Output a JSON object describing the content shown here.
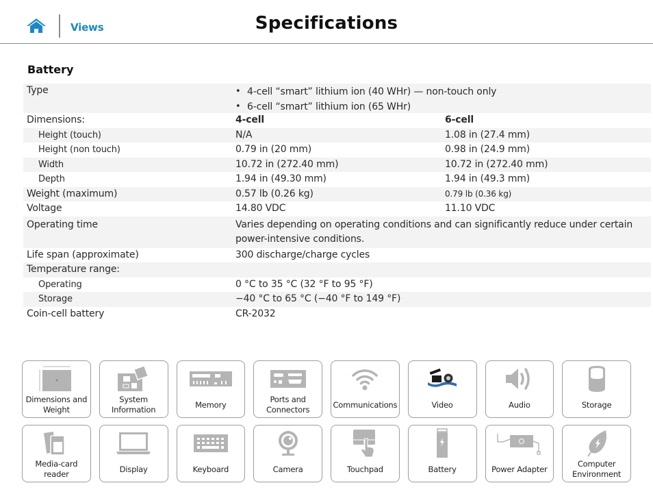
{
  "header": {
    "home_icon": "home-icon",
    "views_label": "Views",
    "title": "Specifications"
  },
  "colors": {
    "accent": "#1b87c9",
    "row_shade": "#f3f3f3",
    "icon_gray": "#b4b4b4",
    "tile_border": "#9d9d9d"
  },
  "section": {
    "title": "Battery",
    "type_label": "Type",
    "type_items": [
      "4-cell “smart” lithium ion (40 WHr) — non-touch only",
      "6-cell “smart” lithium ion (65 WHr)"
    ],
    "rows": [
      {
        "label": "Dimensions:",
        "c1": "4-cell",
        "c2": "6-cell"
      },
      {
        "label": "Height (touch)",
        "c1": "N/A",
        "c2": "1.08 in (27.4 mm)"
      },
      {
        "label": "Height (non touch)",
        "c1": "0.79 in (20 mm)",
        "c2": "0.98 in (24.9 mm)"
      },
      {
        "label": "Width",
        "c1": "10.72 in (272.40 mm)",
        "c2": "10.72 in (272.40 mm)"
      },
      {
        "label": "Depth",
        "c1": "1.94 in (49.30 mm)",
        "c2": "1.94 in (49.3 mm)"
      },
      {
        "label": "Weight (maximum)",
        "c1": "0.57 lb (0.26 kg)",
        "c2": "0.79 lb (0.36 kg)"
      },
      {
        "label": "Voltage",
        "c1": "14.80 VDC",
        "c2": "11.10 VDC"
      },
      {
        "label": "Operating time",
        "value": "Varies depending on operating conditions and can significantly reduce under certain power-intensive conditions."
      },
      {
        "label": "Life span (approximate)",
        "value": "300 discharge/charge cycles"
      },
      {
        "label": "Temperature range:",
        "value": ""
      },
      {
        "label": "Operating",
        "value": "0 °C to 35 °C (32 °F to 95 °F)"
      },
      {
        "label": "Storage",
        "value": "−40 °C to 65 °C (−40 °F to 149 °F)"
      },
      {
        "label": "Coin-cell battery",
        "value": "CR-2032"
      }
    ]
  },
  "tiles": [
    {
      "label": "Dimensions and Weight",
      "icon": "laptop-dimensions-icon"
    },
    {
      "label": "System Information",
      "icon": "motherboard-icon"
    },
    {
      "label": "Memory",
      "icon": "memory-module-icon"
    },
    {
      "label": "Ports and Connectors",
      "icon": "ports-icon"
    },
    {
      "label": "Communications",
      "icon": "wifi-icon"
    },
    {
      "label": "Video",
      "icon": "film-clapper-icon"
    },
    {
      "label": "Audio",
      "icon": "speaker-icon"
    },
    {
      "label": "Storage",
      "icon": "storage-cylinder-icon"
    },
    {
      "label": "Media-card reader",
      "icon": "media-card-icon"
    },
    {
      "label": "Display",
      "icon": "laptop-display-icon"
    },
    {
      "label": "Keyboard",
      "icon": "keyboard-icon"
    },
    {
      "label": "Camera",
      "icon": "webcam-icon"
    },
    {
      "label": "Touchpad",
      "icon": "touchpad-icon"
    },
    {
      "label": "Battery",
      "icon": "battery-icon"
    },
    {
      "label": "Power Adapter",
      "icon": "power-adapter-icon"
    },
    {
      "label": "Computer Environment",
      "icon": "leaf-icon"
    }
  ]
}
